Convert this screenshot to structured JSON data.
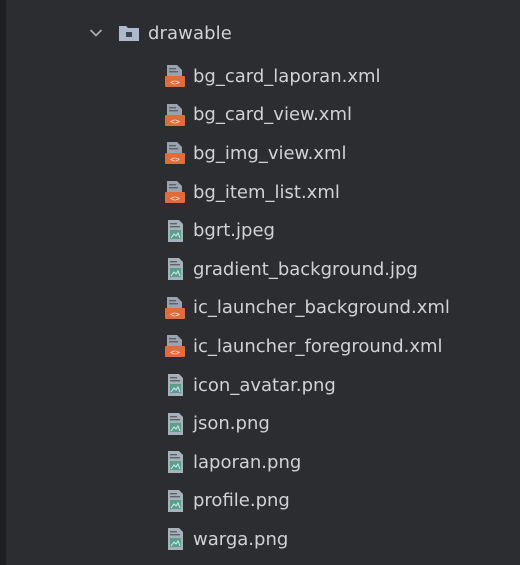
{
  "folder": {
    "name": "drawable",
    "expanded_icon": "chevron-down-icon",
    "icon": "folder-icon"
  },
  "files": [
    {
      "name": "bg_card_laporan.xml",
      "type": "xml"
    },
    {
      "name": "bg_card_view.xml",
      "type": "xml"
    },
    {
      "name": "bg_img_view.xml",
      "type": "xml"
    },
    {
      "name": "bg_item_list.xml",
      "type": "xml"
    },
    {
      "name": "bgrt.jpeg",
      "type": "image"
    },
    {
      "name": "gradient_background.jpg",
      "type": "image"
    },
    {
      "name": "ic_launcher_background.xml",
      "type": "xml"
    },
    {
      "name": "ic_launcher_foreground.xml",
      "type": "xml"
    },
    {
      "name": "icon_avatar.png",
      "type": "image"
    },
    {
      "name": "json.png",
      "type": "image"
    },
    {
      "name": "laporan.png",
      "type": "image"
    },
    {
      "name": "profile.png",
      "type": "image"
    },
    {
      "name": "warga.png",
      "type": "image"
    }
  ],
  "colors": {
    "background": "#2b2d30",
    "text": "#d0d2d6",
    "xml_icon": "#e06c3c",
    "image_icon": "#5b9e8e"
  }
}
